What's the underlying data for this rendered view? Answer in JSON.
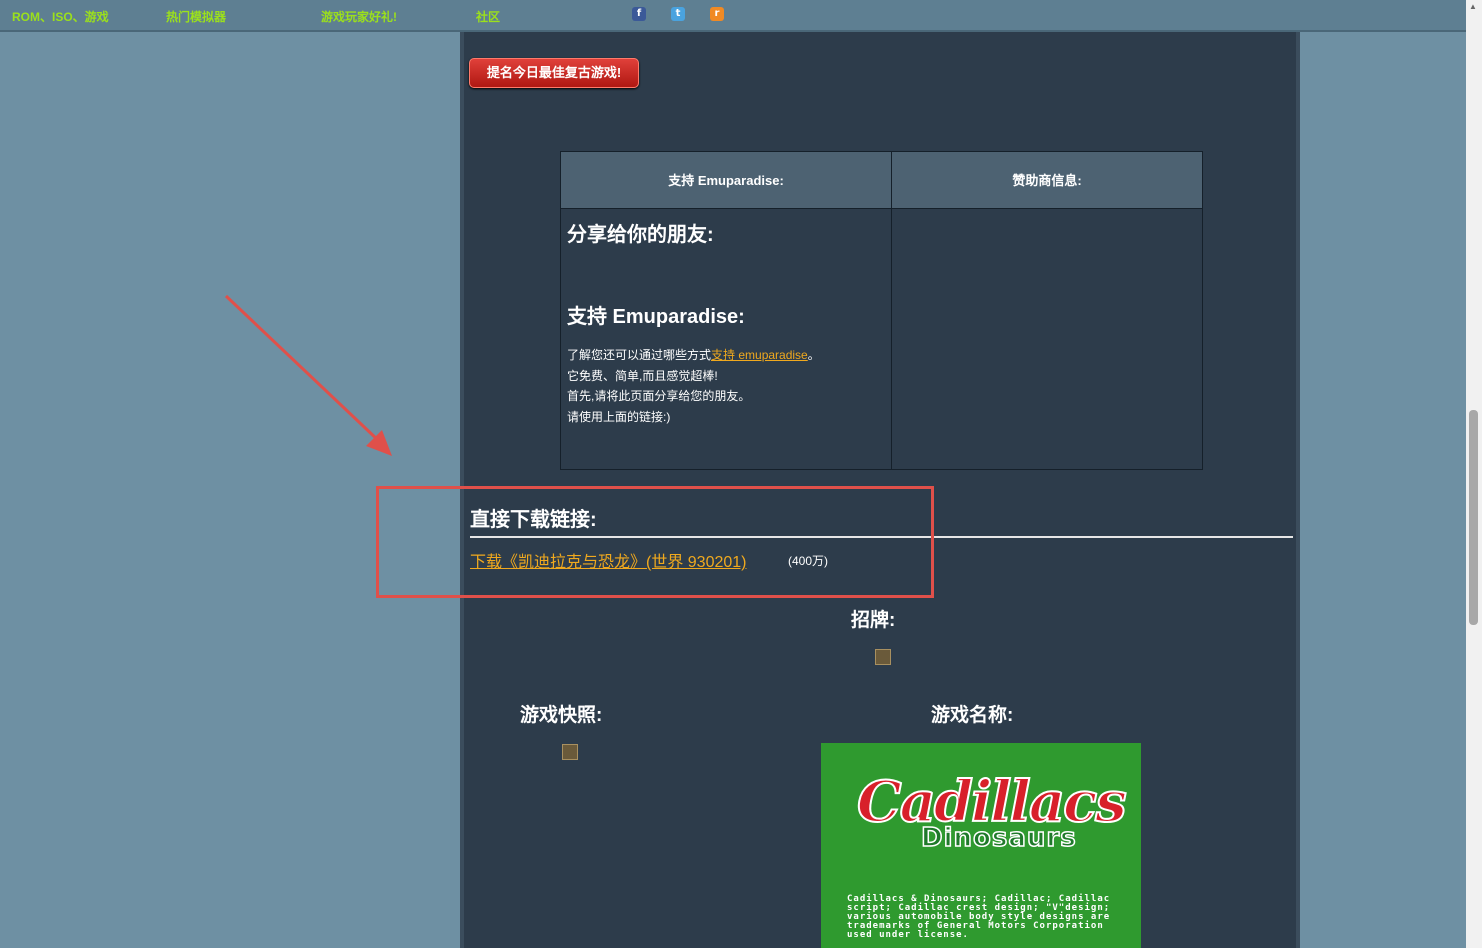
{
  "nav": {
    "items": [
      "ROM、ISO、游戏",
      "热门模拟器",
      "游戏玩家好礼!",
      "社区"
    ]
  },
  "social": {
    "facebook": "f",
    "twitter": "t",
    "rss": "r"
  },
  "nominate_button": "提名今日最佳复古游戏!",
  "table": {
    "header_left": "支持 Emuparadise:",
    "header_right": "赞助商信息:",
    "share_heading": "分享给你的朋友:",
    "support_heading": "支持 Emuparadise:",
    "line1_prefix": "了解您还可以通过哪些方式",
    "line1_link": "支持 emuparadise",
    "line1_suffix": "。",
    "line2": "它免费、简单,而且感觉超棒!",
    "line3": "首先,请将此页面分享给您的朋友。",
    "line4": "请使用上面的链接:)"
  },
  "download": {
    "heading": "直接下载链接:",
    "link": "下载《凯迪拉克与恐龙》(世界 930201)",
    "size": "(400万)"
  },
  "sections": {
    "signboard": "招牌:",
    "snapshot": "游戏快照:",
    "title_name": "游戏名称:"
  },
  "title_screen": {
    "logo_top": "Cadillacs",
    "logo_bottom": "Dinosaurs",
    "fine_print": "Cadillacs & Dinosaurs; Cadillac; Cadillac script; Cadillac crest design; \"V\"design; various automobile body style designs are trademarks of General Motors Corporation used under license."
  },
  "colors": {
    "page_bg": "#6e90a3",
    "content_bg": "#2d3c4b",
    "nav_text": "#9be01c",
    "link": "#f0a91e",
    "highlight": "#e0504a"
  }
}
